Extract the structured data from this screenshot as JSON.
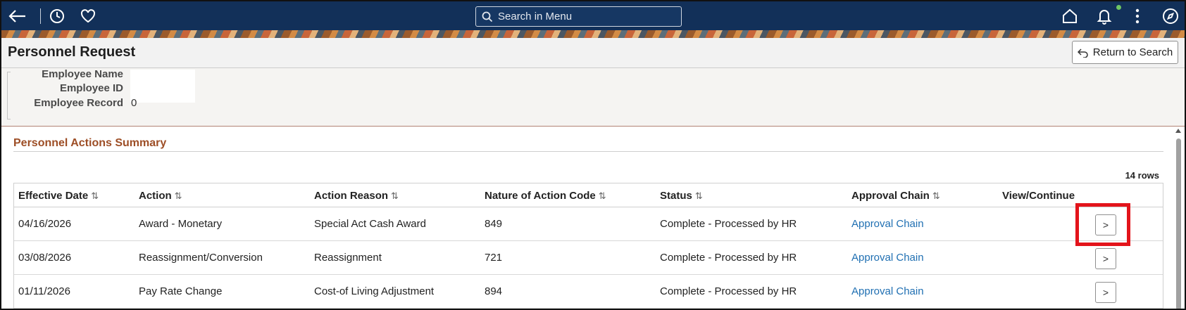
{
  "topbar": {
    "search_placeholder": "Search in Menu",
    "icons": [
      "back-arrow-icon",
      "history-icon",
      "favorite-heart-icon",
      "search-icon",
      "home-icon",
      "notifications-bell-icon",
      "more-menu-icon",
      "navigator-compass-icon"
    ]
  },
  "page": {
    "title": "Personnel Request",
    "return_button": "Return to Search"
  },
  "employee": {
    "name_label": "Employee Name",
    "id_label": "Employee ID",
    "record_label": "Employee Record",
    "record_value": "0"
  },
  "section": {
    "title": "Personnel Actions Summary",
    "row_count": "14 rows"
  },
  "grid": {
    "columns": [
      "Effective Date",
      "Action",
      "Action Reason",
      "Nature of Action Code",
      "Status",
      "Approval Chain",
      "View/Continue"
    ],
    "rows": [
      {
        "date": "04/16/2026",
        "action": "Award - Monetary",
        "reason": "Special Act Cash Award",
        "noa": "849",
        "status": "Complete - Processed by HR",
        "chain": "Approval Chain"
      },
      {
        "date": "03/08/2026",
        "action": "Reassignment/Conversion",
        "reason": "Reassignment",
        "noa": "721",
        "status": "Complete - Processed by HR",
        "chain": "Approval Chain"
      },
      {
        "date": "01/11/2026",
        "action": "Pay Rate Change",
        "reason": "Cost-of Living Adjustment",
        "noa": "894",
        "status": "Complete - Processed by HR",
        "chain": "Approval Chain"
      }
    ]
  },
  "colors": {
    "banner": "#123059",
    "section_title": "#9d4e26",
    "link": "#1f6fb2",
    "highlight": "#e3141b"
  }
}
